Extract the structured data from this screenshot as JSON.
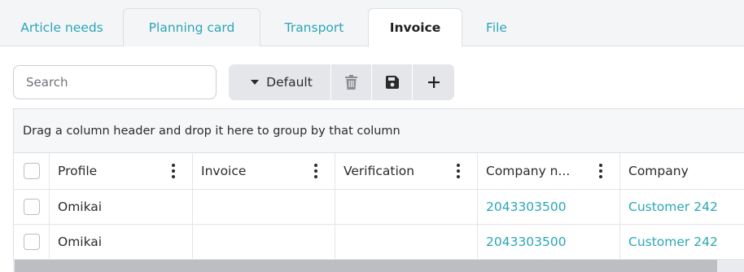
{
  "tabs": [
    {
      "label": "Article needs"
    },
    {
      "label": "Planning card"
    },
    {
      "label": "Transport"
    },
    {
      "label": "Invoice",
      "active": true
    },
    {
      "label": "File"
    }
  ],
  "toolbar": {
    "search_placeholder": "Search",
    "view_label": "Default",
    "view_icon": "caret-down-icon",
    "delete_icon": "trash-icon",
    "save_icon": "floppy-disk-icon",
    "add_icon": "plus-icon"
  },
  "grid": {
    "group_panel_text": "Drag a column header and drop it here to group by that column",
    "columns": [
      "Profile",
      "Invoice",
      "Verification",
      "Company n...",
      "Company"
    ],
    "rows": [
      {
        "profile": "Omikai",
        "invoice": "",
        "verification": "",
        "company_number": "2043303500",
        "company": "Customer 242"
      },
      {
        "profile": "Omikai",
        "invoice": "",
        "verification": "",
        "company_number": "2043303500",
        "company": "Customer 242"
      }
    ]
  },
  "colors": {
    "accent": "#2aa6b8",
    "tab_background": "#f4f5f7",
    "button_group": "#e4e6ea"
  }
}
